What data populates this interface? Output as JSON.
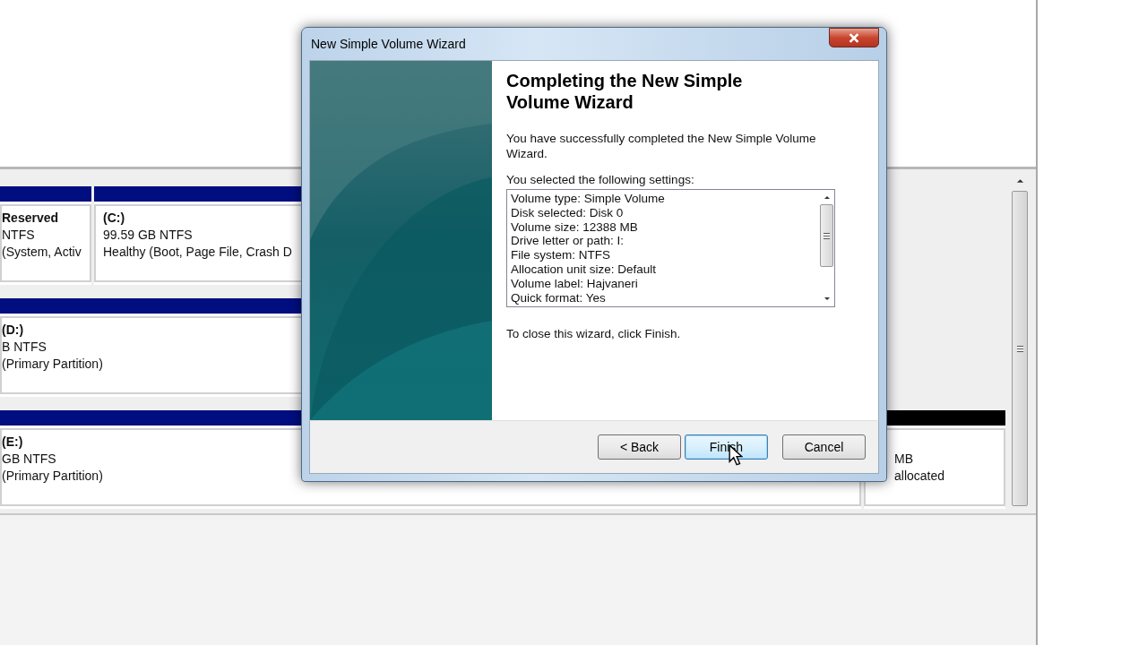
{
  "disks": [
    {
      "partitions": [
        {
          "kind": "system",
          "lines": [
            "Reserved",
            "NTFS",
            "(System, Activ"
          ]
        },
        {
          "kind": "primary",
          "lines": [
            "(C:)",
            "99.59 GB NTFS",
            "Healthy (Boot, Page File, Crash D"
          ]
        }
      ]
    },
    {
      "partitions": [
        {
          "kind": "primary",
          "lines": [
            "(D:)",
            "B NTFS",
            "(Primary Partition)"
          ]
        }
      ]
    },
    {
      "partitions": [
        {
          "kind": "primary",
          "lines": [
            "(E:)",
            "GB NTFS",
            "(Primary Partition)"
          ]
        },
        {
          "kind": "unallocated",
          "lines": [
            "MB",
            "allocated"
          ]
        }
      ]
    }
  ],
  "dialog": {
    "title": "New Simple Volume Wizard",
    "heading": "Completing the New Simple Volume Wizard",
    "intro": "You have successfully completed the New Simple Volume Wizard.",
    "settings_label": "You selected the following settings:",
    "settings": [
      "Volume type: Simple Volume",
      "Disk selected: Disk 0",
      "Volume size: 12388 MB",
      "Drive letter or path: I:",
      "File system: NTFS",
      "Allocation unit size: Default",
      "Volume label: Hajvaneri",
      "Quick format: Yes"
    ],
    "closing": "To close this wizard, click Finish.",
    "buttons": [
      {
        "label": "< Back",
        "focused": false
      },
      {
        "label": "Finish",
        "focused": true
      },
      {
        "label": "Cancel",
        "focused": false
      }
    ]
  }
}
